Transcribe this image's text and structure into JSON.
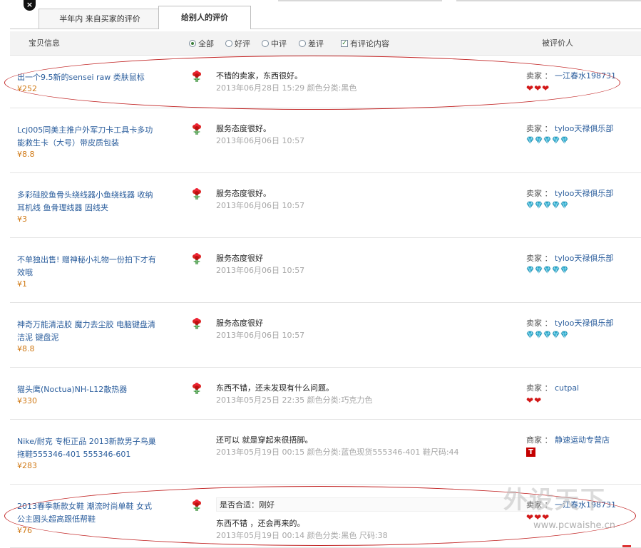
{
  "window": {
    "close_glyph": "×"
  },
  "tabs": [
    {
      "label": "半年内 来自买家的评价",
      "active": false
    },
    {
      "label": "给别人的评价",
      "active": true
    }
  ],
  "header": {
    "item_col": "宝贝信息",
    "filters": [
      {
        "label": "全部",
        "type": "radio",
        "checked": true
      },
      {
        "label": "好评",
        "type": "radio",
        "checked": false
      },
      {
        "label": "中评",
        "type": "radio",
        "checked": false
      },
      {
        "label": "差评",
        "type": "radio",
        "checked": false
      },
      {
        "label": "有评论内容",
        "type": "checkbox",
        "checked": true
      }
    ],
    "rated_col": "被评价人"
  },
  "reviews": [
    {
      "title": "出一个9.5新的sensei raw 类肤鼠标",
      "price": "¥252",
      "comment": "不错的卖家，东西很好。",
      "meta": "2013年06月28日 15:29 颜色分类:黑色",
      "role": "卖家 ：",
      "seller": "一江春水198731",
      "mark": "heart",
      "mark_count": 3
    },
    {
      "title": "Lcj005同美主推户外军刀卡工具卡多功能救生卡（大号）带皮质包装",
      "price": "¥8.8",
      "comment": "服务态度很好。",
      "meta": "2013年06月06日 10:57",
      "role": "卖家 ：",
      "seller": "tyloo天禄俱乐部",
      "mark": "diamond",
      "mark_count": 5
    },
    {
      "title": "多彩硅胶鱼骨头绕线器小鱼绕线器 收纳耳机线 鱼骨理线器 固线夹",
      "price": "¥3",
      "comment": "服务态度很好。",
      "meta": "2013年06月06日 10:57",
      "role": "卖家 ：",
      "seller": "tyloo天禄俱乐部",
      "mark": "diamond",
      "mark_count": 5
    },
    {
      "title": "不单独出售! 赠神秘小礼物一份拍下才有效哦",
      "price": "¥1",
      "comment": "服务态度很好",
      "meta": "2013年06月06日 10:57",
      "role": "卖家 ：",
      "seller": "tyloo天禄俱乐部",
      "mark": "diamond",
      "mark_count": 5
    },
    {
      "title": "神奇万能清洁胶 魔力去尘胶 电脑键盘清洁泥 键盘泥",
      "price": "¥8.8",
      "comment": "服务态度很好",
      "meta": "2013年06月06日 10:57",
      "role": "卖家 ：",
      "seller": "tyloo天禄俱乐部",
      "mark": "diamond",
      "mark_count": 5
    },
    {
      "title": "猫头鹰(Noctua)NH-L12散热器",
      "price": "¥330",
      "comment": "东西不错，还未发现有什么问题。",
      "meta": "2013年05月25日 22:35 颜色分类:巧克力色",
      "role": "卖家 ：",
      "seller": "cutpal",
      "mark": "heart",
      "mark_count": 2
    },
    {
      "title": "Nike/耐克 专柜正品 2013新款男子鸟巢拖鞋555346-401 555346-601",
      "price": "¥283",
      "comment": "还可以 就是穿起来很捂脚。",
      "meta": "2013年05月19日 00:15 颜色分类:蓝色现货555346-401  鞋尺码:44",
      "role": "商家 ：",
      "seller": "静速运动专营店",
      "mark": "tmall",
      "mark_count": 1,
      "mark_glyph": "T",
      "show_flower": false
    },
    {
      "title": "2013春季新款女鞋 潮流时尚单鞋 女式公主圆头超高跟低帮鞋",
      "price": "¥76",
      "extra": "是否合适：刚好",
      "comment": "东西不错 ，还会再来的。",
      "meta": "2013年05月19日 00:14 颜色分类:黑色  尺码:38",
      "role": "卖家 ：",
      "seller": "一江春水198731",
      "mark": "heart",
      "mark_count": 3
    }
  ],
  "watermark": {
    "brand": "外设天下",
    "url": "www.pcwaishe.cn"
  },
  "colors": {
    "link": "#2a5d9c",
    "price": "#d07a17",
    "meta": "#a6a6a6",
    "heart": "#d21818",
    "diamond": "#27a7c9",
    "annotation": "#c22626"
  }
}
